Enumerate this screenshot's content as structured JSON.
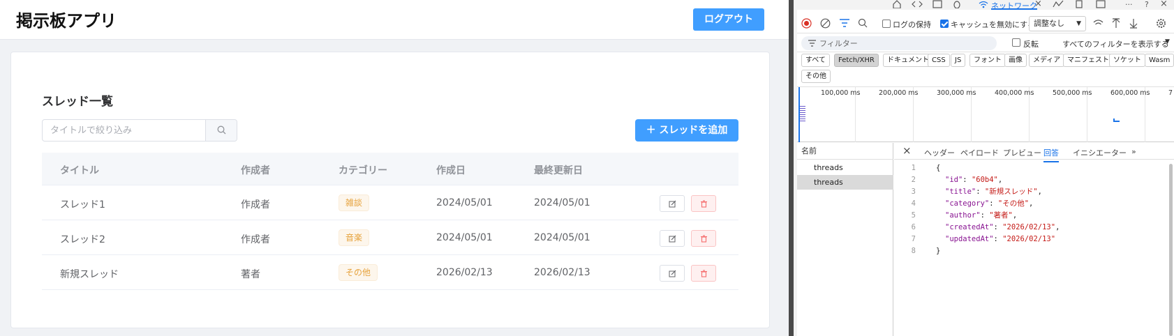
{
  "app": {
    "title": "掲示板アプリ",
    "logout_label": "ログアウト",
    "card_title": "スレッド一覧",
    "search_placeholder": "タイトルで絞り込み",
    "add_label": "＋ スレッドを追加",
    "columns": [
      "タイトル",
      "作成者",
      "カテゴリー",
      "作成日",
      "最終更新日"
    ],
    "rows": [
      {
        "title": "スレッド1",
        "author": "作成者",
        "category": "雑談",
        "created": "2024/05/01",
        "updated": "2024/05/01"
      },
      {
        "title": "スレッド2",
        "author": "作成者",
        "category": "音楽",
        "created": "2024/05/01",
        "updated": "2024/05/01"
      },
      {
        "title": "新規スレッド",
        "author": "著者",
        "category": "その他",
        "created": "2026/02/13",
        "updated": "2026/02/13"
      }
    ],
    "colors": {
      "primary": "#409eff",
      "danger": "#f56c6c",
      "warning": "#e6a23c"
    }
  },
  "devtools": {
    "network_tab_label": "ネットワーク",
    "preserve_log": "ログの保持",
    "disable_cache": "キャッシュを無効にする",
    "throttle": "調整なし",
    "filter_placeholder": "フィルター",
    "invert": "反転",
    "show_all_filters": "すべてのフィルターを表示する",
    "type_filters": [
      "すべて",
      "Fetch/XHR",
      "ドキュメント",
      "CSS",
      "JS",
      "フォント",
      "画像",
      "メディア",
      "マニフェスト",
      "ソケット",
      "Wasm",
      "その他"
    ],
    "active_filter": "Fetch/XHR",
    "timeline_ticks": [
      "100,000 ms",
      "200,000 ms",
      "300,000 ms",
      "400,000 ms",
      "500,000 ms",
      "600,000 ms",
      "7"
    ],
    "name_header": "名前",
    "requests": [
      "threads",
      "threads"
    ],
    "detail_tabs": [
      "ヘッダー",
      "ペイロード",
      "プレビュー",
      "回答",
      "イニシエーター"
    ],
    "active_detail_tab": "回答",
    "response_lines": [
      {
        "n": "1",
        "text": "{"
      },
      {
        "n": "2",
        "key": "\"id\"",
        "val": "\"60b4\"",
        "tail": ","
      },
      {
        "n": "3",
        "key": "\"title\"",
        "val": "\"新規スレッド\"",
        "tail": ","
      },
      {
        "n": "4",
        "key": "\"category\"",
        "val": "\"その他\"",
        "tail": ","
      },
      {
        "n": "5",
        "key": "\"author\"",
        "val": "\"著者\"",
        "tail": ","
      },
      {
        "n": "6",
        "key": "\"createdAt\"",
        "val": "\"2026/02/13\"",
        "tail": ","
      },
      {
        "n": "7",
        "key": "\"updatedAt\"",
        "val": "\"2026/02/13\"",
        "tail": ""
      },
      {
        "n": "8",
        "text": "}"
      }
    ]
  }
}
